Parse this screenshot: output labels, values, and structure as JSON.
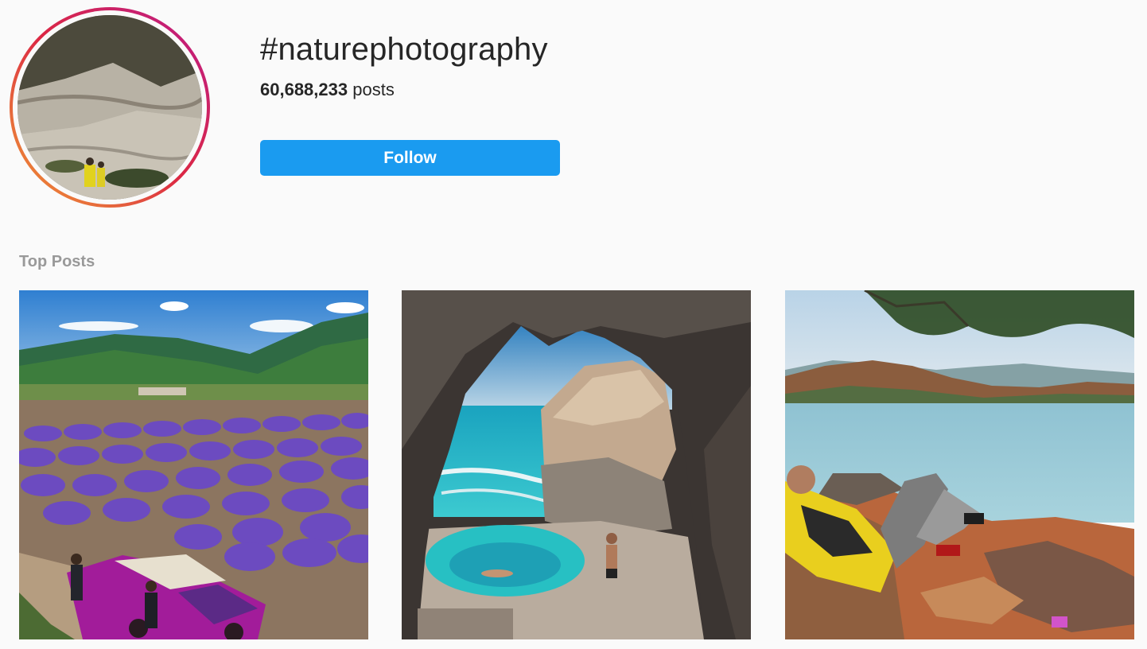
{
  "hashtag": {
    "title": "#naturephotography",
    "post_count": "60,688,233",
    "post_count_suffix": "posts",
    "follow_label": "Follow"
  },
  "colors": {
    "follow_button": "#1a9bf0",
    "section_label": "#999999",
    "background": "#fafafa"
  },
  "sections": {
    "top_posts_label": "Top Posts"
  },
  "top_posts": [
    {
      "image": "lavender-field-car-photo"
    },
    {
      "image": "sea-cave-lagoon-photo"
    },
    {
      "image": "lake-hiker-resting-photo"
    }
  ]
}
